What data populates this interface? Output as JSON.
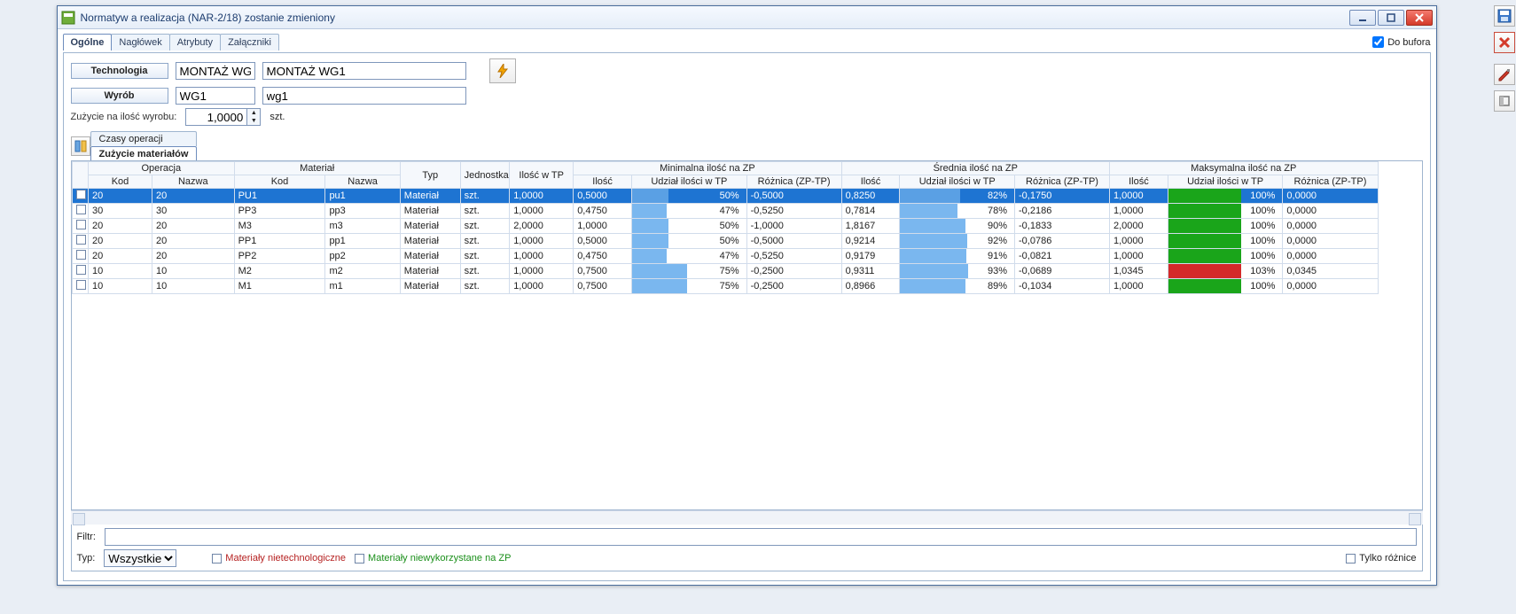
{
  "window": {
    "title": "Normatyw a realizacja  (NAR-2/18) zostanie zmieniony"
  },
  "topbar": {
    "tabs": [
      "Ogólne",
      "Nagłówek",
      "Atrybuty",
      "Załączniki"
    ],
    "active_tab": 0,
    "buffer_label": "Do bufora"
  },
  "form": {
    "technologia_label": "Technologia",
    "technologia_code": "MONTAŻ WG1",
    "technologia_name": "MONTAŻ WG1",
    "wyrob_label": "Wyrób",
    "wyrob_code": "WG1",
    "wyrob_name": "wg1",
    "zuzycie_label": "Zużycie na ilość wyrobu:",
    "zuzycie_value": "1,0000",
    "unit": "szt."
  },
  "midtabs": {
    "tabs": [
      "Czasy operacji",
      "Zużycie materiałów"
    ],
    "active": 1
  },
  "grid": {
    "group_headers": {
      "operacja": "Operacja",
      "material": "Materiał",
      "typ": "Typ",
      "jednostka": "Jednostka",
      "ilosc_tp": "Ilość w TP",
      "min": "Minimalna ilość na ZP",
      "avg": "Średnia ilość na ZP",
      "max": "Maksymalna ilość na ZP"
    },
    "col_headers": {
      "kod": "Kod",
      "nazwa": "Nazwa",
      "ilosc": "Ilość",
      "udzial": "Udział ilości w TP",
      "roznica": "Różnica (ZP-TP)"
    },
    "rows": [
      {
        "sel": true,
        "op_kod": "20",
        "op_nazwa": "20",
        "mat_kod": "PU1",
        "mat_nazwa": "pu1",
        "typ": "Materiał",
        "j": "szt.",
        "tp": "1,0000",
        "min_il": "0,5000",
        "min_u": 50,
        "min_r": "-0,5000",
        "avg_il": "0,8250",
        "avg_u": 82,
        "avg_r": "-0,1750",
        "max_il": "1,0000",
        "max_u": 100,
        "max_r": "0,0000",
        "max_color": "green"
      },
      {
        "sel": false,
        "op_kod": "30",
        "op_nazwa": "30",
        "mat_kod": "PP3",
        "mat_nazwa": "pp3",
        "typ": "Materiał",
        "j": "szt.",
        "tp": "1,0000",
        "min_il": "0,4750",
        "min_u": 47,
        "min_r": "-0,5250",
        "avg_il": "0,7814",
        "avg_u": 78,
        "avg_r": "-0,2186",
        "max_il": "1,0000",
        "max_u": 100,
        "max_r": "0,0000",
        "max_color": "green"
      },
      {
        "sel": false,
        "op_kod": "20",
        "op_nazwa": "20",
        "mat_kod": "M3",
        "mat_nazwa": "m3",
        "typ": "Materiał",
        "j": "szt.",
        "tp": "2,0000",
        "min_il": "1,0000",
        "min_u": 50,
        "min_r": "-1,0000",
        "avg_il": "1,8167",
        "avg_u": 90,
        "avg_r": "-0,1833",
        "max_il": "2,0000",
        "max_u": 100,
        "max_r": "0,0000",
        "max_color": "green"
      },
      {
        "sel": false,
        "op_kod": "20",
        "op_nazwa": "20",
        "mat_kod": "PP1",
        "mat_nazwa": "pp1",
        "typ": "Materiał",
        "j": "szt.",
        "tp": "1,0000",
        "min_il": "0,5000",
        "min_u": 50,
        "min_r": "-0,5000",
        "avg_il": "0,9214",
        "avg_u": 92,
        "avg_r": "-0,0786",
        "max_il": "1,0000",
        "max_u": 100,
        "max_r": "0,0000",
        "max_color": "green"
      },
      {
        "sel": false,
        "op_kod": "20",
        "op_nazwa": "20",
        "mat_kod": "PP2",
        "mat_nazwa": "pp2",
        "typ": "Materiał",
        "j": "szt.",
        "tp": "1,0000",
        "min_il": "0,4750",
        "min_u": 47,
        "min_r": "-0,5250",
        "avg_il": "0,9179",
        "avg_u": 91,
        "avg_r": "-0,0821",
        "max_il": "1,0000",
        "max_u": 100,
        "max_r": "0,0000",
        "max_color": "green"
      },
      {
        "sel": false,
        "op_kod": "10",
        "op_nazwa": "10",
        "mat_kod": "M2",
        "mat_nazwa": "m2",
        "typ": "Materiał",
        "j": "szt.",
        "tp": "1,0000",
        "min_il": "0,7500",
        "min_u": 75,
        "min_r": "-0,2500",
        "avg_il": "0,9311",
        "avg_u": 93,
        "avg_r": "-0,0689",
        "max_il": "1,0345",
        "max_u": 103,
        "max_r": "0,0345",
        "max_color": "red"
      },
      {
        "sel": false,
        "op_kod": "10",
        "op_nazwa": "10",
        "mat_kod": "M1",
        "mat_nazwa": "m1",
        "typ": "Materiał",
        "j": "szt.",
        "tp": "1,0000",
        "min_il": "0,7500",
        "min_u": 75,
        "min_r": "-0,2500",
        "avg_il": "0,8966",
        "avg_u": 89,
        "avg_r": "-0,1034",
        "max_il": "1,0000",
        "max_u": 100,
        "max_r": "0,0000",
        "max_color": "green"
      }
    ]
  },
  "footer": {
    "filter_label": "Filtr:",
    "typ_label": "Typ:",
    "typ_value": "Wszystkie",
    "legend_nietech": "Materiały nietechnologiczne",
    "legend_niewyk": "Materiały niewykorzystane na ZP",
    "only_diff": "Tylko różnice"
  }
}
